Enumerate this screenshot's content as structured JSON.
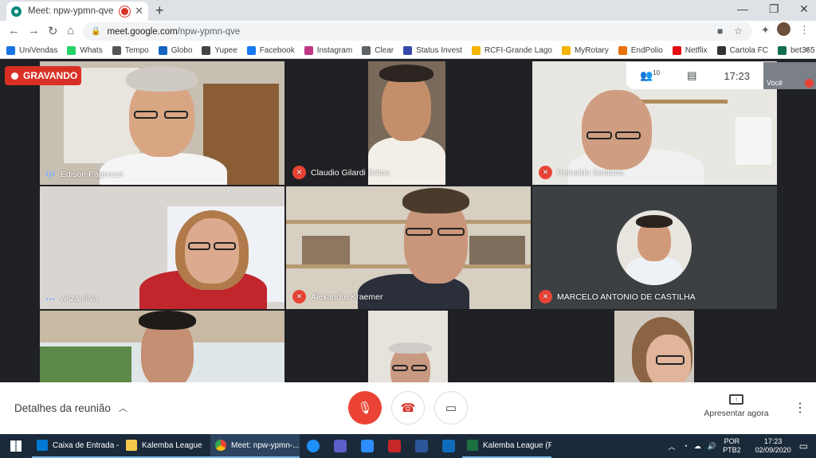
{
  "browser": {
    "tab_title": "Meet: npw-ypmn-qve",
    "url_host": "meet.google.com",
    "url_path": "/npw-ypmn-qve",
    "bookmarks": [
      {
        "label": "UniVendas",
        "color": "#1a73e8"
      },
      {
        "label": "Whats",
        "color": "#25d366"
      },
      {
        "label": "Tempo",
        "color": "#555555"
      },
      {
        "label": "Globo",
        "color": "#1565c0"
      },
      {
        "label": "Yupee",
        "color": "#444444"
      },
      {
        "label": "Facebook",
        "color": "#1877f2"
      },
      {
        "label": "Instagram",
        "color": "#c13584"
      },
      {
        "label": "Clear",
        "color": "#5f6368"
      },
      {
        "label": "Status Invest",
        "color": "#3949ab"
      },
      {
        "label": "RCFI-Grande Lago",
        "color": "#f4b400"
      },
      {
        "label": "MyRotary",
        "color": "#f4b400"
      },
      {
        "label": "EndPolio",
        "color": "#e8710a"
      },
      {
        "label": "Netflix",
        "color": "#e50914"
      },
      {
        "label": "Cartola FC",
        "color": "#333333"
      },
      {
        "label": "bet365",
        "color": "#126e51"
      }
    ]
  },
  "meet": {
    "recording_label": "GRAVANDO",
    "participant_count": "10",
    "time": "17:23",
    "self_label": "Você",
    "participants": [
      {
        "name": "Edison Pagnozzi",
        "muted": false
      },
      {
        "name": "Claudio Gilardi Britos",
        "muted": true
      },
      {
        "name": "Reinaldo Santana",
        "muted": true
      },
      {
        "name": "wilza silva",
        "muted": false
      },
      {
        "name": "Alexandre Kraemer",
        "muted": true
      },
      {
        "name": "MARCELO ANTONIO DE CASTILHA",
        "muted": true
      }
    ],
    "details_label": "Detalhes da reunião",
    "present_label": "Apresentar agora"
  },
  "taskbar": {
    "items": [
      {
        "label": "Caixa de Entrada - f...",
        "color": "#0078d4"
      },
      {
        "label": "Kalemba League",
        "color": "#f2c94c"
      },
      {
        "label": "Meet: npw-ypmn-...",
        "color": "#34a853"
      },
      {
        "label": "Kalemba League (P...",
        "color": "#1d6f42"
      }
    ],
    "lang_top": "POR",
    "lang_bottom": "PTB2",
    "clock_time": "17:23",
    "clock_date": "02/09/2020"
  }
}
